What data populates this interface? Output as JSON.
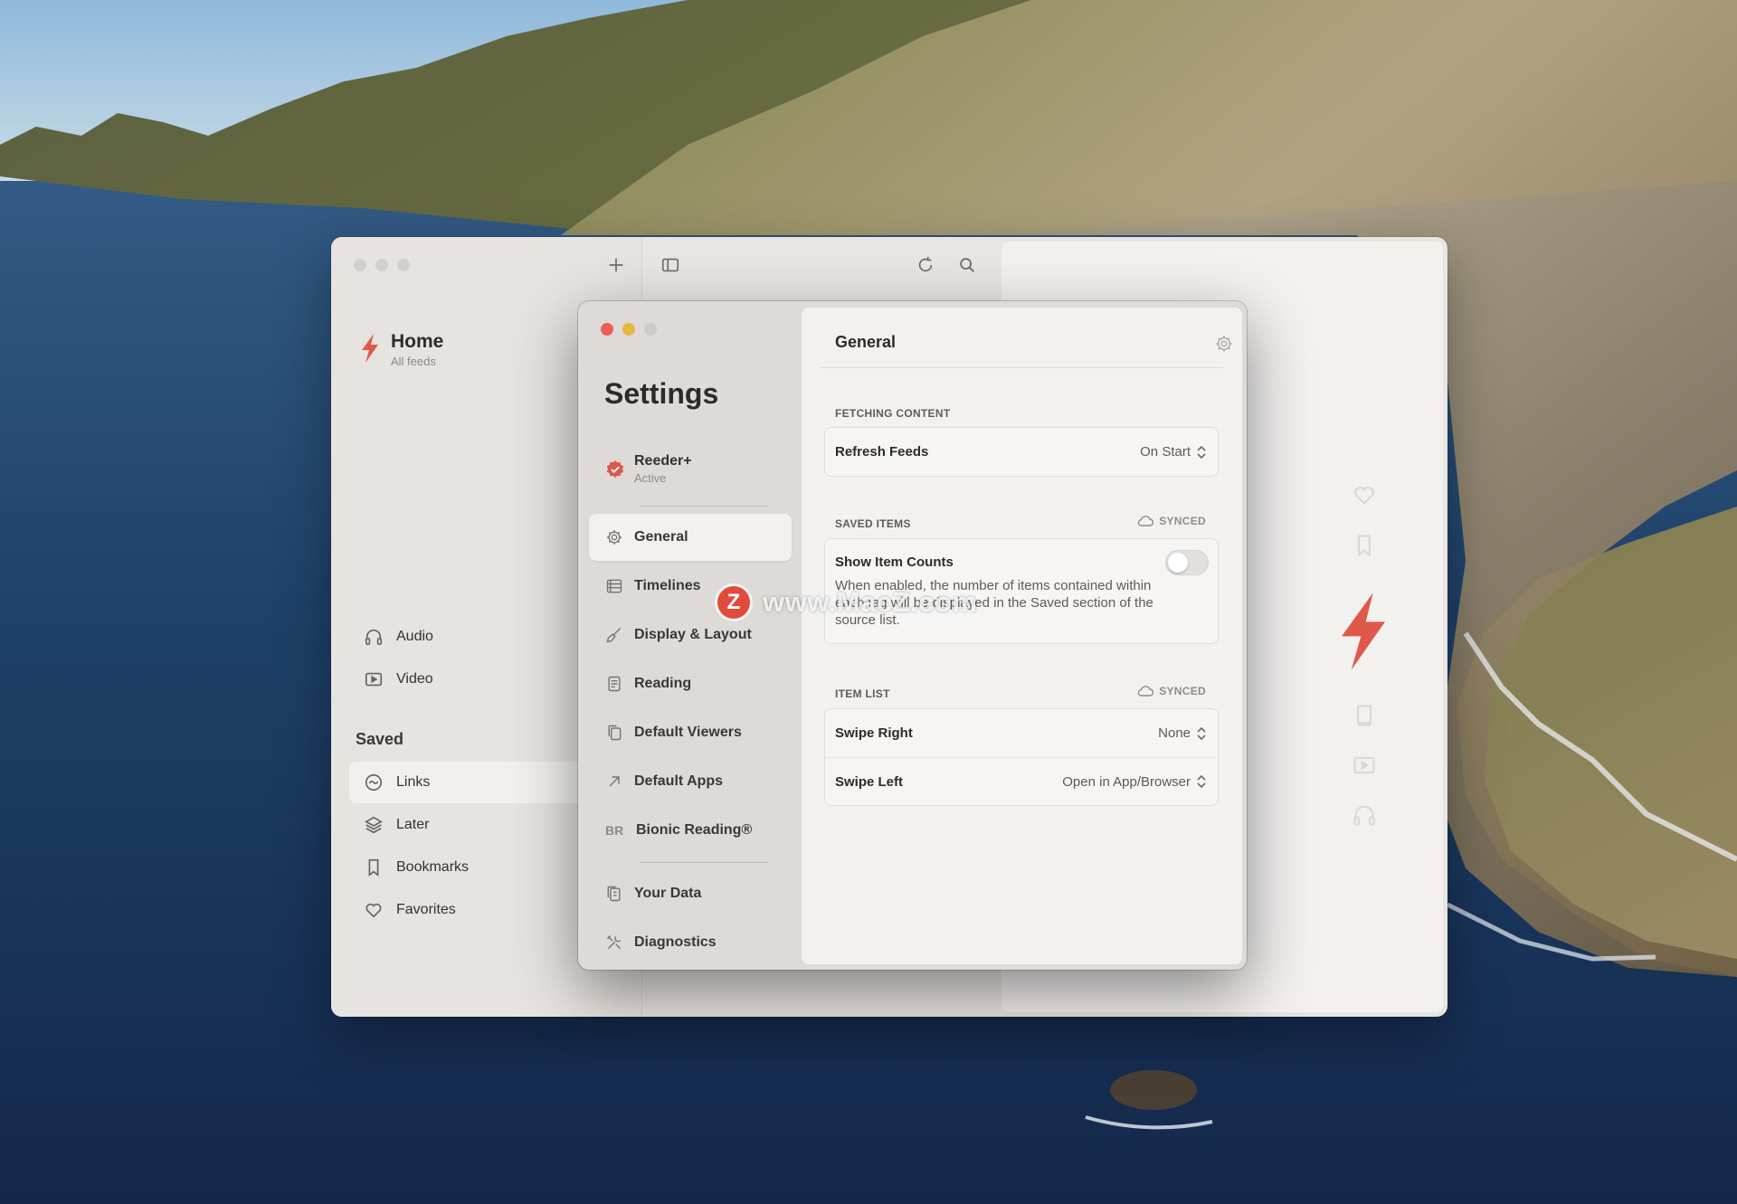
{
  "main_window": {
    "home": {
      "title": "Home",
      "subtitle": "All feeds"
    },
    "nav_items": [
      {
        "label": "Audio",
        "icon": "headphones-icon"
      },
      {
        "label": "Video",
        "icon": "play-icon"
      }
    ],
    "saved_section": "Saved",
    "saved_items": [
      {
        "label": "Links",
        "icon": "link-icon",
        "selected": true
      },
      {
        "label": "Later",
        "icon": "layers-icon"
      },
      {
        "label": "Bookmarks",
        "icon": "bookmark-icon"
      },
      {
        "label": "Favorites",
        "icon": "heart-icon"
      }
    ],
    "toolbar_icons": [
      "add-icon",
      "sidebar-toggle-icon",
      "refresh-icon",
      "search-icon"
    ],
    "accent_color": "#e0584a"
  },
  "settings": {
    "title": "Settings",
    "subscription": {
      "name": "Reeder+",
      "status": "Active"
    },
    "nav": [
      {
        "label": "General",
        "icon": "gear-icon",
        "selected": true
      },
      {
        "label": "Timelines",
        "icon": "timelines-icon"
      },
      {
        "label": "Display & Layout",
        "icon": "brush-icon"
      },
      {
        "label": "Reading",
        "icon": "document-icon"
      },
      {
        "label": "Default Viewers",
        "icon": "copy-icon"
      },
      {
        "label": "Default Apps",
        "icon": "arrow-up-right-icon"
      },
      {
        "label": "Bionic Reading®",
        "icon": "BR"
      },
      {
        "label": "Your Data",
        "icon": "data-icon"
      },
      {
        "label": "Diagnostics",
        "icon": "tools-icon"
      }
    ],
    "content": {
      "title": "General",
      "sections": {
        "fetching": {
          "label": "FETCHING CONTENT",
          "refresh_feeds": {
            "label": "Refresh Feeds",
            "value": "On Start"
          }
        },
        "saved_items": {
          "label": "SAVED ITEMS",
          "synced": "SYNCED",
          "show_item_counts": {
            "label": "Show Item Counts",
            "description": "When enabled, the number of items contained within each tag will be displayed in the Saved section of the source list.",
            "enabled": false
          }
        },
        "item_list": {
          "label": "ITEM LIST",
          "synced": "SYNCED",
          "swipe_right": {
            "label": "Swipe Right",
            "value": "None"
          },
          "swipe_left": {
            "label": "Swipe Left",
            "value": "Open in App/Browser"
          }
        }
      }
    }
  },
  "watermark": {
    "logo": "Z",
    "text": "www.MacZ.com"
  }
}
